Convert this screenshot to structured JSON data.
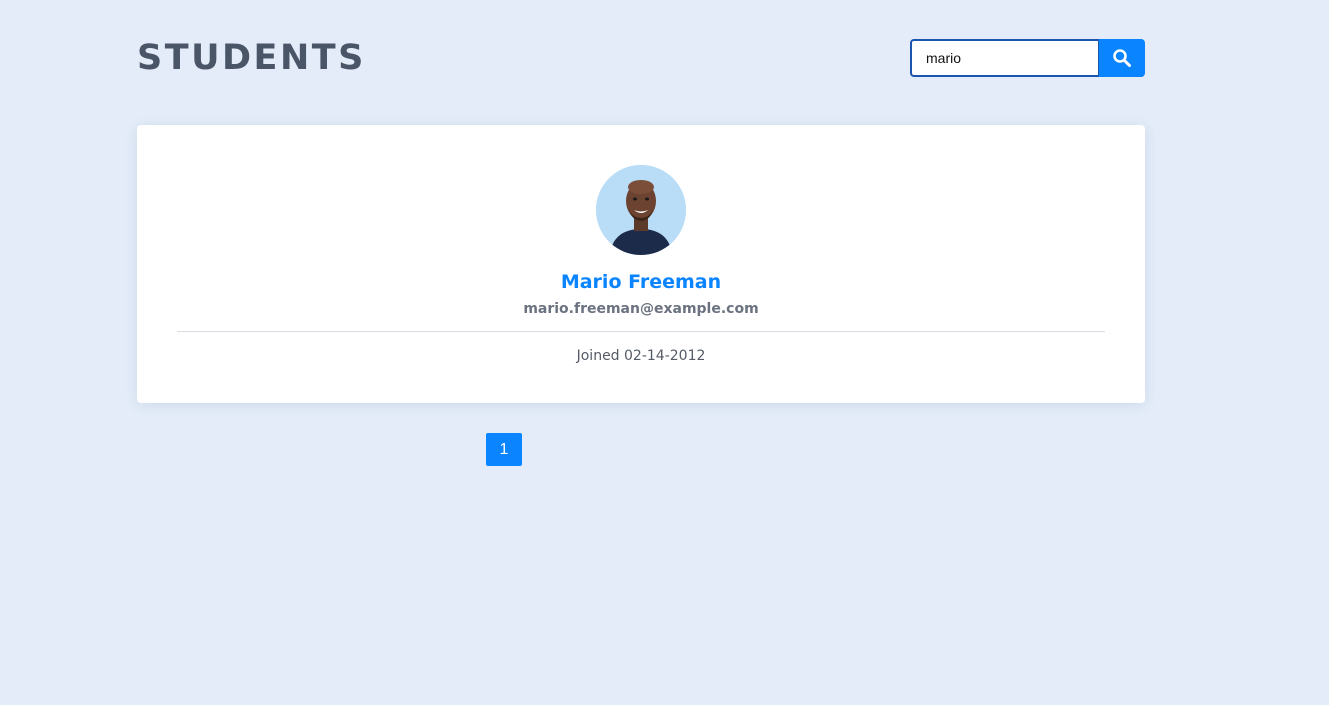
{
  "header": {
    "title": "STUDENTS"
  },
  "search": {
    "value": "mario",
    "icon": "search-icon"
  },
  "students": [
    {
      "name": "Mario Freeman",
      "email": "mario.freeman@example.com",
      "joined": "Joined 02-14-2012",
      "avatar": "avatar-photo"
    }
  ],
  "pagination": {
    "pages": [
      "1"
    ],
    "current": "1"
  },
  "colors": {
    "background": "#e3ecf8",
    "accent": "#0a84ff",
    "title": "#4a5568"
  }
}
